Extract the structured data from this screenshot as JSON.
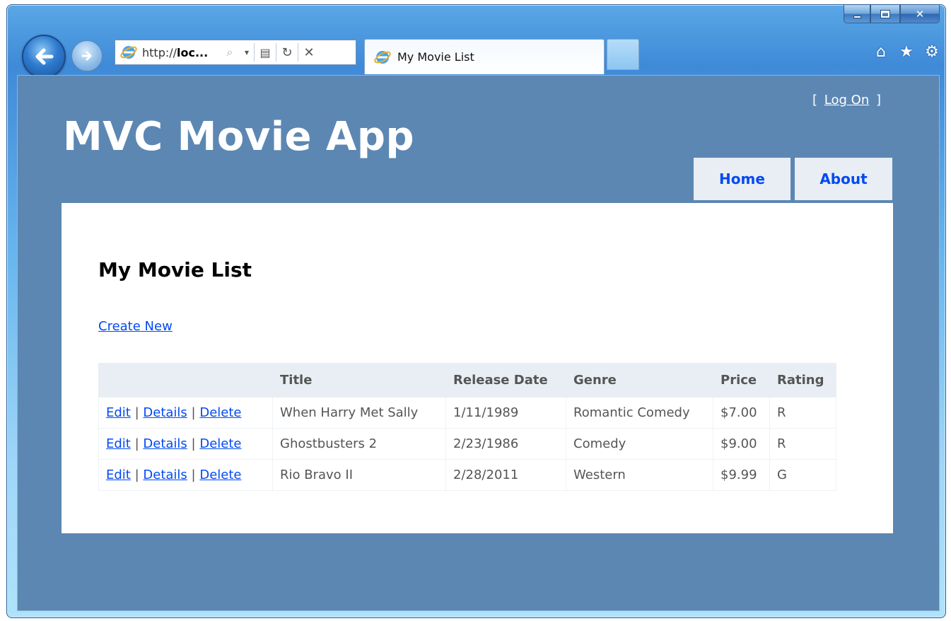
{
  "browser": {
    "address": {
      "prefix": "http://",
      "host": "loc...",
      "suffix": ""
    },
    "tab_title": "My Movie List",
    "window_buttons": {
      "minimize": "minimize",
      "maximize": "maximize",
      "close": "x"
    },
    "command_icons": [
      "home-icon",
      "star-icon",
      "gear-icon"
    ]
  },
  "site": {
    "title": "MVC Movie App",
    "login": {
      "open_bracket": "[",
      "link": "Log On",
      "close_bracket": "]"
    },
    "menu": [
      {
        "label": "Home"
      },
      {
        "label": "About"
      }
    ]
  },
  "page": {
    "heading": "My Movie List",
    "create_link": "Create New",
    "table": {
      "headers": [
        "",
        "Title",
        "Release Date",
        "Genre",
        "Price",
        "Rating"
      ],
      "action_labels": {
        "edit": "Edit",
        "details": "Details",
        "delete": "Delete",
        "sep": "|"
      },
      "rows": [
        {
          "title": "When Harry Met Sally",
          "release_date": "1/11/1989",
          "genre": "Romantic Comedy",
          "price": "$7.00",
          "rating": "R"
        },
        {
          "title": "Ghostbusters 2",
          "release_date": "2/23/1986",
          "genre": "Comedy",
          "price": "$9.00",
          "rating": "R"
        },
        {
          "title": "Rio Bravo II",
          "release_date": "2/28/2011",
          "genre": "Western",
          "price": "$9.99",
          "rating": "G"
        }
      ]
    }
  },
  "colors": {
    "page_background": "#5c87b2",
    "link": "#034af3",
    "menu_background": "#e8eef4",
    "header_text": "#ffffff"
  }
}
